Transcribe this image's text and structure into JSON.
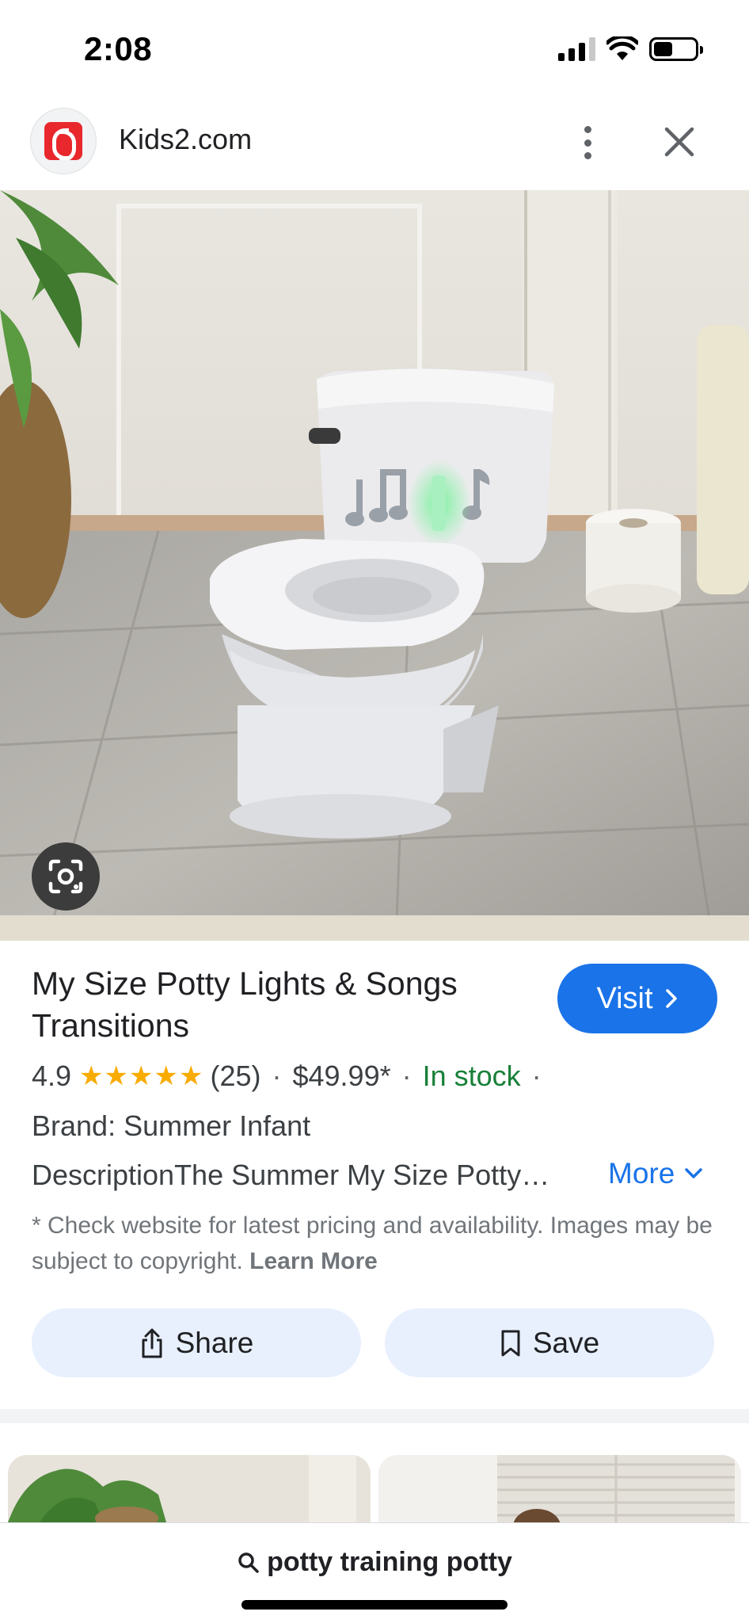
{
  "status_bar": {
    "time": "2:08",
    "icons": [
      "cellular-signal-icon",
      "wifi-icon",
      "battery-icon"
    ]
  },
  "header": {
    "site_name": "Kids2.com",
    "favicon": "kids2-logo-icon",
    "icons": [
      "more-vert-icon",
      "close-icon"
    ]
  },
  "hero": {
    "lens_icon": "google-lens-icon"
  },
  "product": {
    "title": "My Size Potty Lights & Songs Transitions",
    "visit_label": "Visit",
    "rating": "4.9",
    "stars": "★★★★★",
    "review_count": "(25)",
    "price": "$49.99*",
    "availability": "In stock",
    "brand": "Brand: Summer Infant",
    "description": "DescriptionThe Summer My Size Potty…",
    "more_label": "More",
    "disclaimer_text": "* Check website for latest pricing and availability. Images may be subject to copyright.",
    "learn_more": "Learn More"
  },
  "actions": {
    "share_label": "Share",
    "save_label": "Save"
  },
  "search": {
    "query": "potty training potty"
  },
  "colors": {
    "accent_blue": "#1a73e8",
    "stock_green": "#188038",
    "star_yellow": "#f9ab00",
    "pill_bg": "#e8f0fe"
  }
}
